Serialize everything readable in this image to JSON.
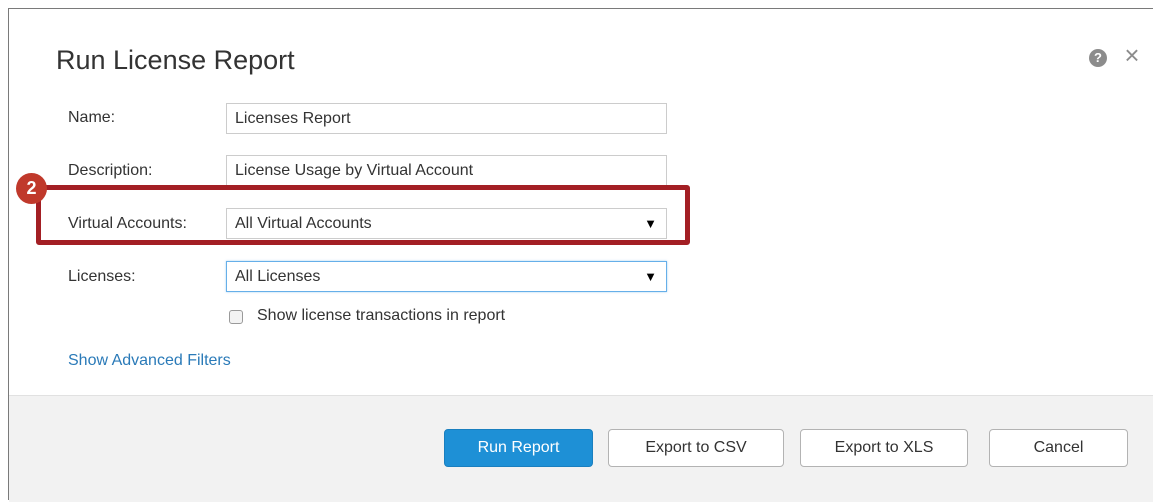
{
  "dialog": {
    "title": "Run License Report",
    "help_icon": "?",
    "close_icon": "×"
  },
  "form": {
    "name_label": "Name:",
    "name_value": "Licenses Report",
    "description_label": "Description:",
    "description_value": "License Usage by Virtual Account",
    "virtual_accounts_label": "Virtual Accounts:",
    "virtual_accounts_value": "All Virtual Accounts",
    "licenses_label": "Licenses:",
    "licenses_value": "All Licenses",
    "dropdown_caret": "▼",
    "show_transactions_label": "Show license transactions in report",
    "show_transactions_checked": false,
    "advanced_filters_link": "Show Advanced Filters"
  },
  "annotation": {
    "step_number": "2",
    "highlight_color": "#a31f24"
  },
  "footer": {
    "run_report": "Run Report",
    "export_csv": "Export to CSV",
    "export_xls": "Export to XLS",
    "cancel": "Cancel"
  },
  "colors": {
    "primary_button": "#1e90d6",
    "link": "#2a7ab8"
  }
}
